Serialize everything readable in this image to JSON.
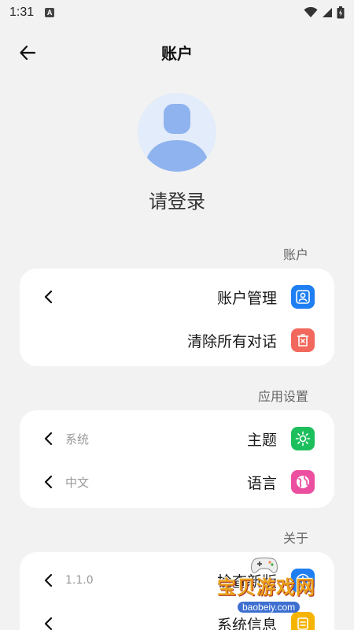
{
  "status": {
    "time": "1:31",
    "notification_letter": "A"
  },
  "header": {
    "title": "账户"
  },
  "profile": {
    "login_text": "请登录"
  },
  "sections": {
    "account": {
      "title": "账户",
      "items": [
        {
          "label": "账户管理",
          "value": "",
          "icon": "user-card-icon",
          "color": "#1f7ff2"
        },
        {
          "label": "清除所有对话",
          "value": "",
          "icon": "delete-icon",
          "color": "#f2685c"
        }
      ]
    },
    "app": {
      "title": "应用设置",
      "items": [
        {
          "label": "主题",
          "value": "系统",
          "icon": "sun-icon",
          "color": "#1dbf5d"
        },
        {
          "label": "语言",
          "value": "中文",
          "icon": "globe-icon",
          "color": "#ec4fa0"
        }
      ]
    },
    "about": {
      "title": "关于",
      "items": [
        {
          "label": "检查新版",
          "value": "1.1.0",
          "icon": "info-icon",
          "color": "#1f7ff2"
        },
        {
          "label": "系统信息",
          "value": "",
          "icon": "document-icon",
          "color": "#f5b400"
        }
      ]
    }
  },
  "watermark": {
    "text": "宝贝游戏网",
    "url": "baobeiy.com"
  }
}
